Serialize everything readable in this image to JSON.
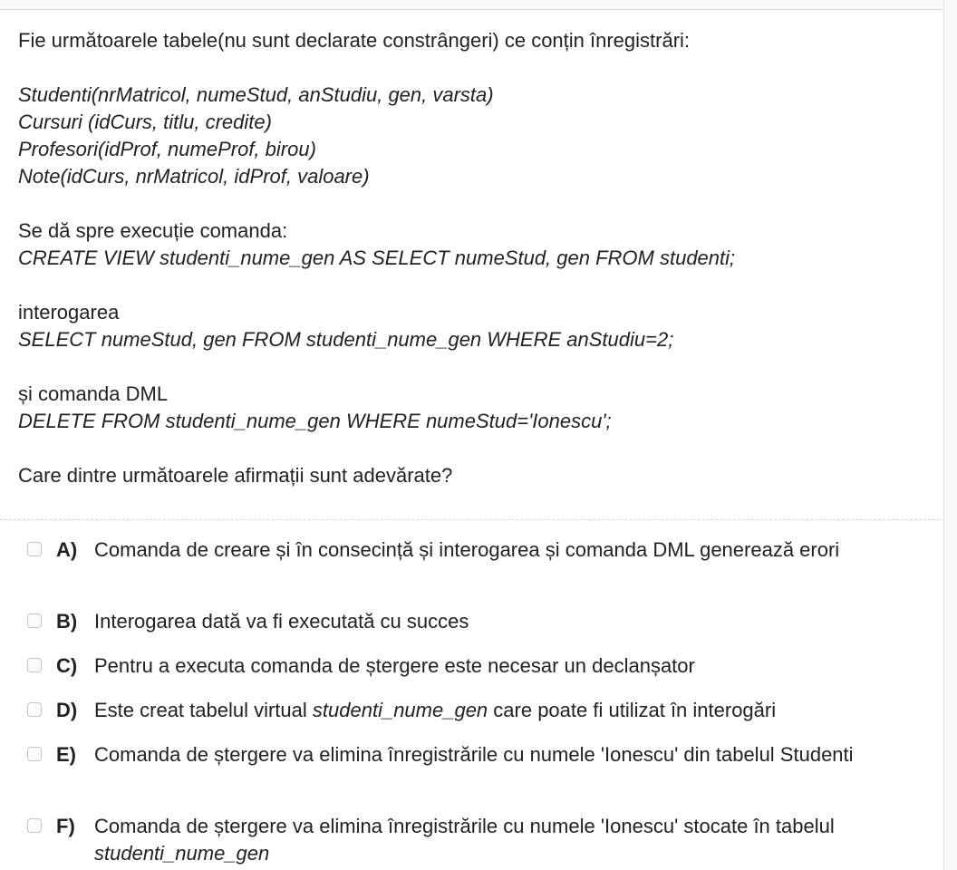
{
  "question": {
    "intro": "Fie următoarele tabele(nu sunt declarate constrângeri) ce conțin înregistrări:",
    "tables": [
      "Studenti(nrMatricol, numeStud, anStudiu, gen, varsta)",
      "Cursuri (idCurs, titlu, credite)",
      "Profesori(idProf, numeProf, birou)",
      "Note(idCurs, nrMatricol, idProf, valoare)"
    ],
    "command_label": "Se dă spre execuție comanda:",
    "command": "CREATE VIEW studenti_nume_gen AS SELECT numeStud, gen FROM studenti;",
    "query_label": "interogarea",
    "query": "SELECT numeStud, gen FROM studenti_nume_gen WHERE anStudiu=2;",
    "dml_label": "și comanda DML",
    "dml": "DELETE FROM studenti_nume_gen WHERE numeStud='Ionescu';",
    "prompt": "Care dintre următoarele afirmații sunt adevărate?"
  },
  "options": [
    {
      "letter": "A)",
      "text": "Comanda de creare și în consecință și interogarea și comanda DML generează erori",
      "checked": false
    },
    {
      "letter": "B)",
      "text": "Interogarea dată va fi executată cu succes",
      "checked": false
    },
    {
      "letter": "C)",
      "text": "Pentru a executa comanda de ștergere este necesar un declanșator",
      "checked": false
    },
    {
      "letter": "D)",
      "text_before": "Este creat tabelul virtual ",
      "text_italic": "studenti_nume_gen",
      "text_after": " care poate fi utilizat în interogări",
      "checked": false
    },
    {
      "letter": "E)",
      "text": "Comanda de ștergere va elimina înregistrările cu numele 'Ionescu' din tabelul Studenti",
      "checked": false
    },
    {
      "letter": "F)",
      "text_before": "Comanda de ștergere va elimina înregistrările cu numele 'Ionescu' stocate în tabelul ",
      "text_italic": "studenti_nume_gen",
      "checked": false
    }
  ]
}
